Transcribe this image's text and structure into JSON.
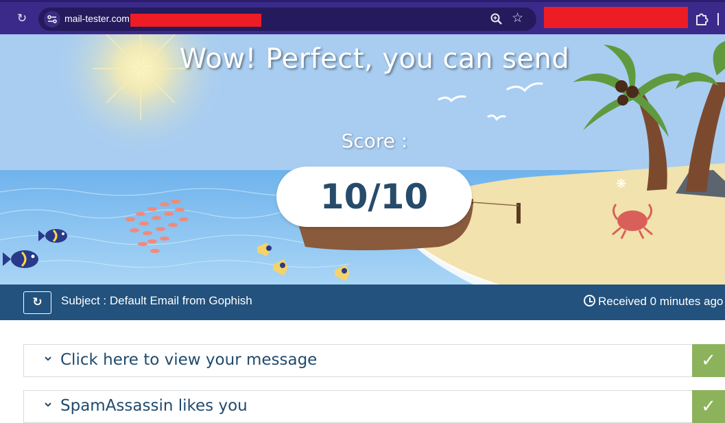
{
  "browser": {
    "url_host": "mail-tester.com",
    "reload_icon": "reload-icon",
    "site_info_icon": "site-info-icon",
    "zoom_icon": "zoom-icon",
    "bookmark_icon": "star-icon",
    "extensions_icon": "puzzle-icon"
  },
  "hero": {
    "title": "Wow! Perfect, you can send",
    "score_label": "Score :",
    "score_value": "10/10"
  },
  "subject_bar": {
    "refresh_icon": "refresh-icon",
    "subject": "Subject : Default Email from Gophish",
    "received": "Received 0 minutes ago"
  },
  "panels": [
    {
      "title": "Click here to view your message",
      "status": "check-icon"
    },
    {
      "title": "SpamAssassin likes you",
      "status": "check-icon"
    }
  ],
  "colors": {
    "browser_toolbar": "#3c2a8a",
    "subject_bar": "#22527d",
    "score_text": "#274b6b",
    "check_badge": "#8cb35b",
    "redaction": "#ee1c24"
  }
}
